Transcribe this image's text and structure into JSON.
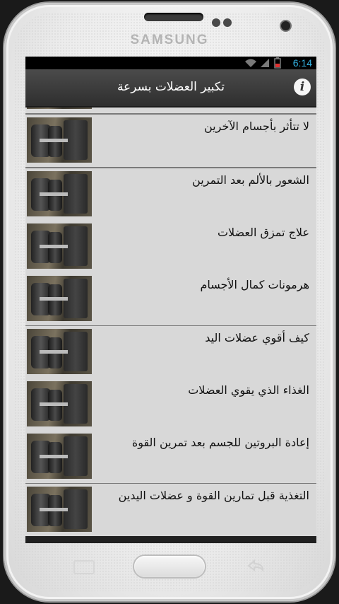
{
  "device": {
    "brand": "SAMSUNG"
  },
  "status_bar": {
    "time": "6:14",
    "accent_color": "#35b5e5"
  },
  "action_bar": {
    "title": "تكبير العضلات بسرعة",
    "info_icon": "info-icon"
  },
  "list": {
    "items": [
      {
        "label": "لا تتأثر بأجسام الآخرين"
      },
      {
        "label": "الشعور بالألم بعد التمرين"
      },
      {
        "label": "علاج تمزق العضلات"
      },
      {
        "label": "هرمونات كمال الأجسام"
      },
      {
        "label": "كيف أقوي عضلات اليد"
      },
      {
        "label": "الغذاء الذي يقوي العضلات"
      },
      {
        "label": "إعادة البروتين للجسم بعد تمرين القوة"
      },
      {
        "label": "التغذية قبل تمارين القوة و عضلات اليدين"
      }
    ]
  }
}
